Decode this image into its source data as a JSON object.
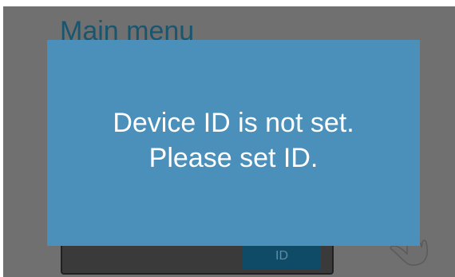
{
  "screen": {
    "title": "Main menu",
    "id_button_label": "ID"
  },
  "modal": {
    "line1": "Device ID is not set.",
    "line2": "Please set ID."
  },
  "icons": {
    "pointer": "hand-pointer-icon"
  },
  "colors": {
    "screen_background": "#707070",
    "modal_background": "#4a90bb",
    "title_text": "#18566f",
    "button_background": "#0f4a66"
  }
}
